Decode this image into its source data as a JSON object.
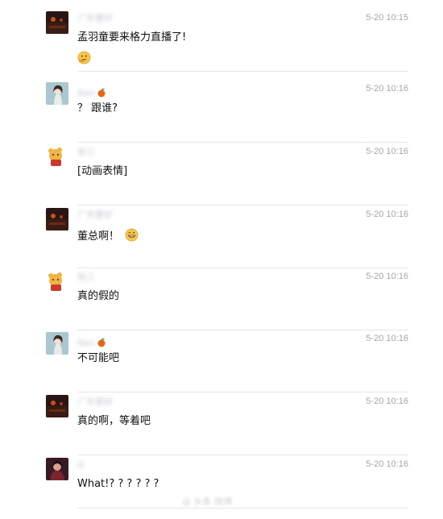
{
  "messages": [
    {
      "id": 1,
      "sender": "广东爱好",
      "avatar": "avatar-dark-room",
      "time": "5-20 10:15",
      "text": "孟羽童要来格力直播了!",
      "emoji_after": "thinking-emoji"
    },
    {
      "id": 2,
      "sender": "Nan",
      "sender_icon": "orange-icon",
      "avatar": "avatar-girl",
      "time": "5-20 10:16",
      "text": "？ 跟谁?"
    },
    {
      "id": 3,
      "sender": "张三",
      "avatar": "avatar-pooh",
      "time": "5-20 10:16",
      "text": "[动画表情]"
    },
    {
      "id": 4,
      "sender": "广东爱好",
      "avatar": "avatar-dark-room",
      "time": "5-20 10:16",
      "text": "董总啊！",
      "emoji_inline": "grin-emoji"
    },
    {
      "id": 5,
      "sender": "张三",
      "avatar": "avatar-pooh",
      "time": "5-20 10:16",
      "text": "真的假的"
    },
    {
      "id": 6,
      "sender": "Nan",
      "sender_icon": "orange-icon",
      "avatar": "avatar-girl",
      "time": "5-20 10:16",
      "text": "不可能吧"
    },
    {
      "id": 7,
      "sender": "广东爱好",
      "avatar": "avatar-dark-room",
      "time": "5-20 10:16",
      "text": "真的啊，等着吧"
    },
    {
      "id": 8,
      "sender": "Q",
      "avatar": "avatar-portrait",
      "time": "5-20 10:16",
      "text": "What!? ? ? ? ? ?"
    }
  ],
  "watermark": "@ 头条 微博"
}
